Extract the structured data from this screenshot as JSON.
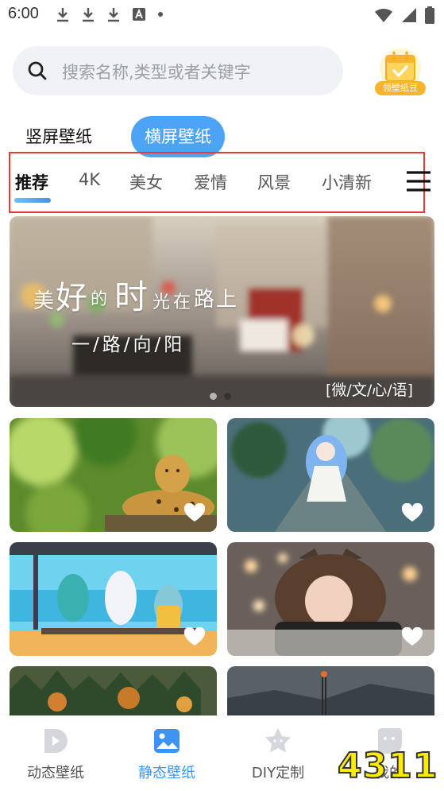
{
  "status": {
    "time": "6:00"
  },
  "search": {
    "placeholder": "搜索名称,类型或者关键字",
    "coupon_label": "领壁纸豆"
  },
  "orientation_tabs": [
    "竖屏壁纸",
    "横屏壁纸"
  ],
  "categories": [
    "推荐",
    "4K",
    "美女",
    "爱情",
    "风景",
    "小清新"
  ],
  "banner": {
    "line1": [
      "美",
      "好",
      "的",
      "时",
      "光",
      "在",
      "路",
      "上"
    ],
    "line2": "一/路/向/阳",
    "tag": "[微/文/心/语]"
  },
  "bottom_nav": [
    "动态壁纸",
    "静态壁纸",
    "DIY定制",
    "我的"
  ],
  "watermark": "4311",
  "colors": {
    "accent": "#4da3f5",
    "highlight_outline": "#e53935"
  }
}
